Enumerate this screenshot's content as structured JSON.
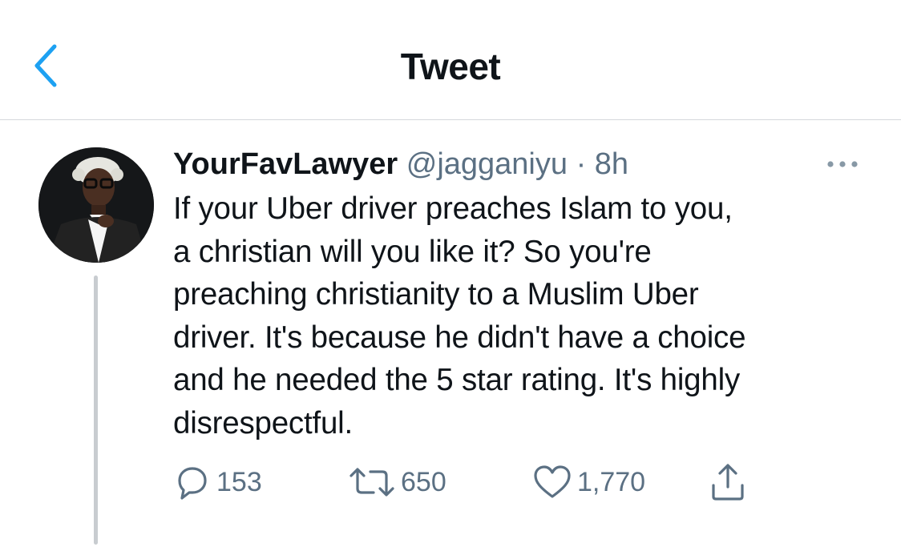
{
  "header": {
    "title": "Tweet"
  },
  "tweet": {
    "display_name": "YourFavLawyer",
    "handle": "@jagganiyu",
    "separator": "·",
    "time": "8h",
    "text": "If your Uber driver preaches Islam to you,\na christian will you like it? So you're\npreaching christianity to a Muslim Uber\ndriver. It's because he didn't have a choice\nand he needed the 5 star rating. It's highly\ndisrespectful.",
    "counts": {
      "replies": "153",
      "retweets": "650",
      "likes": "1,770"
    }
  },
  "icons": {
    "back": "chevron-left-icon",
    "more": "more-horizontal-icon",
    "reply": "reply-bubble-icon",
    "retweet": "retweet-icon",
    "like": "heart-icon",
    "share": "share-icon"
  },
  "colors": {
    "accent": "#1da1f2",
    "text": "#0f1419",
    "secondary": "#5b7083"
  }
}
